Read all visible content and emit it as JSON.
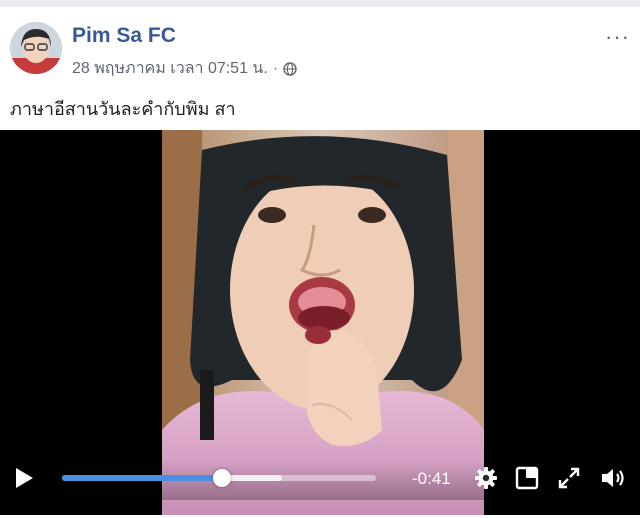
{
  "post": {
    "page_name": "Pim Sa FC",
    "date": "28 พฤษภาคม เวลา 07:51 น.",
    "separator": "·",
    "privacy_icon": "globe-icon",
    "more_label": "···",
    "caption": "ภาษาอีสานวันละคำกับพิม สา"
  },
  "video": {
    "time_remaining": "-0:41",
    "progress_fraction": 0.51,
    "buffered_fraction": 0.7,
    "icons": [
      "play-icon",
      "settings-gear-icon",
      "picture-in-picture-icon",
      "fullscreen-icon",
      "volume-icon"
    ]
  },
  "colors": {
    "page_name": "#385898",
    "progress": "#4a90e2",
    "meta_text": "#616770"
  }
}
